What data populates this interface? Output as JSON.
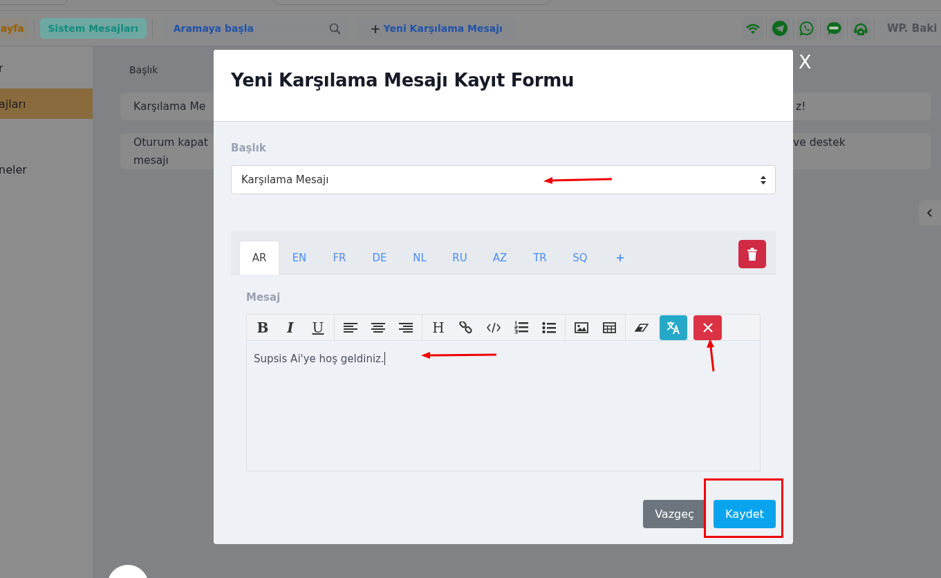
{
  "top_bar": {
    "page_chip": "ayfa",
    "section_chip": "Sistem Mesajları",
    "search": {
      "placeholder": "Aramaya başla"
    },
    "new_button": {
      "icon": "+",
      "label": "Yeni Karşılama Mesajı"
    },
    "account_button": "WP. Baki"
  },
  "sidebar": {
    "items": [
      {
        "label": "r",
        "selected": false
      },
      {
        "label": "ajları",
        "selected": true
      },
      {
        "label": "neler",
        "selected": false
      }
    ]
  },
  "table": {
    "header": "Başlık",
    "rows": [
      {
        "cells": [
          "Karşılama Me",
          "z!"
        ]
      },
      {
        "cells": [
          "Oturum kapat mesajı",
          "ve destek"
        ]
      }
    ]
  },
  "modal": {
    "close": "X",
    "title": "Yeni Karşılama Mesajı Kayıt Formu",
    "field_label": "Başlık",
    "select_value": "Karşılama Mesajı",
    "tabs": [
      {
        "label": "AR",
        "selected": true
      },
      {
        "label": "EN",
        "selected": false
      },
      {
        "label": "FR",
        "selected": false
      },
      {
        "label": "DE",
        "selected": false
      },
      {
        "label": "NL",
        "selected": false
      },
      {
        "label": "RU",
        "selected": false
      },
      {
        "label": "AZ",
        "selected": false
      },
      {
        "label": "TR",
        "selected": false
      },
      {
        "label": "SQ",
        "selected": false
      },
      {
        "label": "+",
        "selected": false
      }
    ],
    "editor_label": "Mesaj",
    "format_letters": [
      "B",
      "I",
      "U"
    ],
    "heading_letter": "H",
    "content": "Supsis Ai'ye hoş geldiniz.",
    "buttons": [
      {
        "label": "Vazgeç",
        "kind": "cancel"
      },
      {
        "label": "Kaydet",
        "kind": "primary"
      }
    ]
  }
}
